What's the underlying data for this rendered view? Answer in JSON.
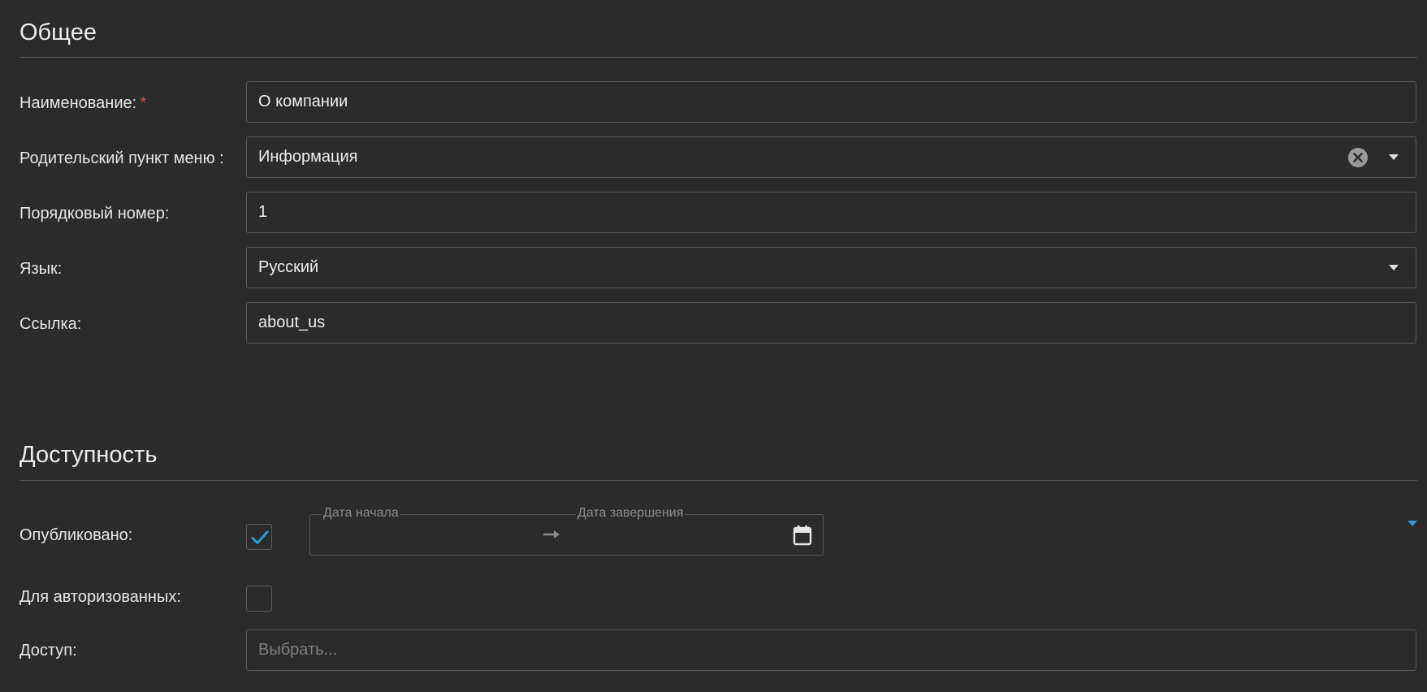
{
  "sections": {
    "general": {
      "title": "Общее"
    },
    "availability": {
      "title": "Доступность"
    }
  },
  "fields": {
    "name": {
      "label": "Наименование:",
      "required_mark": "*",
      "value": "О компании"
    },
    "parent_menu": {
      "label": "Родительский пункт меню :",
      "value": "Информация",
      "clear_icon": "clear-circle-icon",
      "dropdown_icon": "chevron-down-icon"
    },
    "order": {
      "label": "Порядковый номер:",
      "value": "1"
    },
    "language": {
      "label": "Язык:",
      "value": "Русский",
      "dropdown_icon": "chevron-down-icon"
    },
    "link": {
      "label": "Ссылка:",
      "value": "about_us"
    },
    "published": {
      "label": "Опубликовано:",
      "checked": true
    },
    "date_range": {
      "start_label": "Дата начала",
      "end_label": "Дата завершения",
      "start_value": "",
      "end_value": ""
    },
    "authorized_only": {
      "label": "Для авторизованных:",
      "checked": false
    },
    "access": {
      "label": "Доступ:",
      "placeholder": "Выбрать..."
    }
  },
  "colors": {
    "background": "#2b2b2b",
    "border": "#585858",
    "accent": "#2f9bd6",
    "required": "#e34848"
  }
}
